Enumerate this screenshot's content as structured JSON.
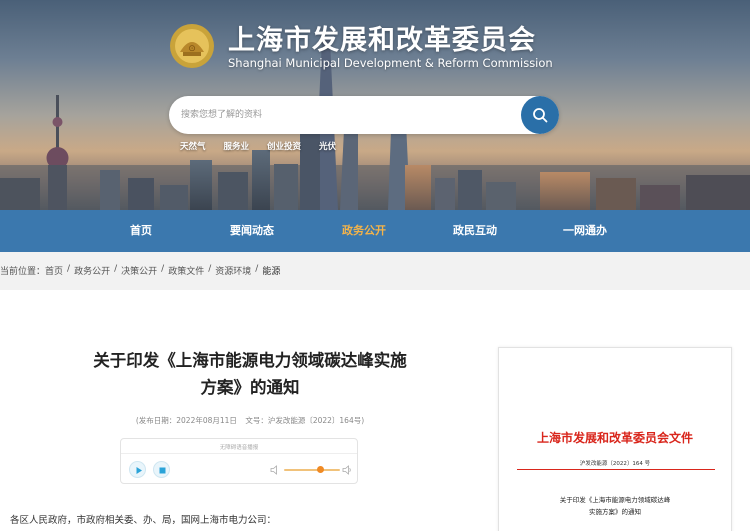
{
  "header": {
    "title": "上海市发展和改革委员会",
    "subtitle": "Shanghai Municipal Development & Reform Commission",
    "logo_icon": "government-emblem-icon"
  },
  "search": {
    "placeholder": "搜索您想了解的资料",
    "button_icon": "search-icon",
    "hot_words": [
      "天然气",
      "服务业",
      "创业投资",
      "光伏"
    ]
  },
  "nav": {
    "items": [
      {
        "label": "首页",
        "active": false
      },
      {
        "label": "要闻动态",
        "active": false
      },
      {
        "label": "政务公开",
        "active": true
      },
      {
        "label": "政民互动",
        "active": false
      },
      {
        "label": "一网通办",
        "active": false
      }
    ],
    "active_color": "#f3b34a",
    "bar_color": "#2c6ea8"
  },
  "breadcrumb": {
    "prefix": "当前位置：",
    "items": [
      "首页",
      "政务公开",
      "决策公开",
      "政策文件",
      "资源环境",
      "能源"
    ],
    "separator": "/"
  },
  "article": {
    "title_line1": "关于印发《上海市能源电力领域碳达峰实施",
    "title_line2": "方案》的通知",
    "publish_date": "(发布日期：2022年08月11日",
    "doc_number": "文号：沪发改能源〔2022〕164号)",
    "audio": {
      "label": "无障碍语音播报",
      "play_icon": "play-icon",
      "stop_icon": "stop-icon",
      "volume_left_icon": "volume-low-icon",
      "volume_right_icon": "volume-high-icon",
      "volume_level": 0.66
    },
    "body_first_line": "各区人民政府，市政府相关委、办、局，国网上海市电力公司："
  },
  "doc_preview": {
    "head": "上海市发展和改革委员会文件",
    "number": "沪发改能源〔2022〕164 号",
    "title_line1": "关于印发《上海市能源电力领域碳达峰",
    "title_line2": "实施方案》的通知",
    "accent_color": "#d9261c"
  }
}
